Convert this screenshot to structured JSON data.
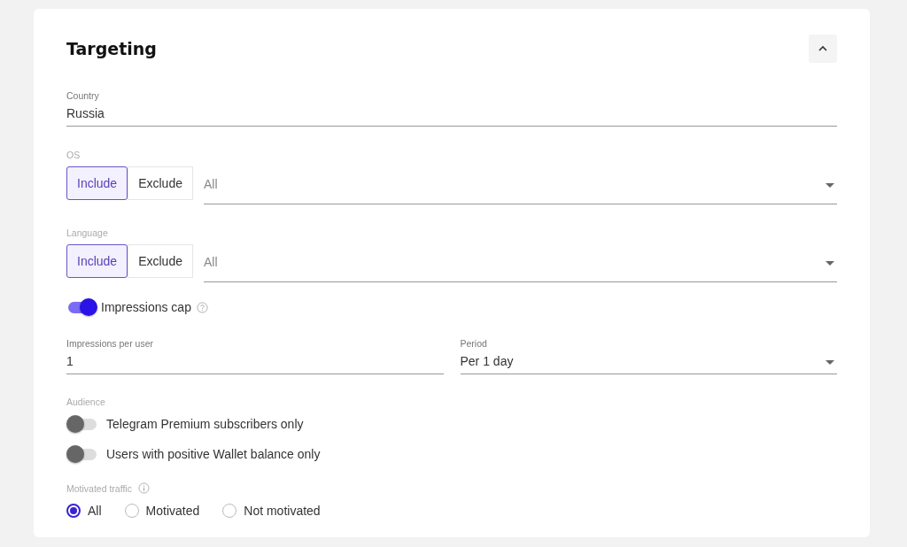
{
  "section": {
    "title": "Targeting",
    "expanded": true
  },
  "country": {
    "label": "Country",
    "value": "Russia"
  },
  "filters": [
    {
      "label": "OS",
      "modes": [
        {
          "label": "Include",
          "selected": true
        },
        {
          "label": "Exclude",
          "selected": false
        }
      ],
      "placeholder": "All"
    },
    {
      "label": "Language",
      "modes": [
        {
          "label": "Include",
          "selected": true
        },
        {
          "label": "Exclude",
          "selected": false
        }
      ],
      "placeholder": "All"
    }
  ],
  "impressions_cap": {
    "label": "Impressions cap",
    "on": true
  },
  "impressions_per_user": {
    "label": "Impressions per user",
    "value": "1"
  },
  "period": {
    "label": "Period",
    "value": "Per 1 day"
  },
  "audience": {
    "label": "Audience",
    "options": [
      {
        "label": "Telegram Premium subscribers only",
        "on": false
      },
      {
        "label": "Users with positive Wallet balance only",
        "on": false
      }
    ]
  },
  "motivated_traffic": {
    "label": "Motivated traffic",
    "options": [
      {
        "label": "All",
        "selected": true
      },
      {
        "label": "Motivated",
        "selected": false
      },
      {
        "label": "Not motivated",
        "selected": false
      }
    ]
  }
}
